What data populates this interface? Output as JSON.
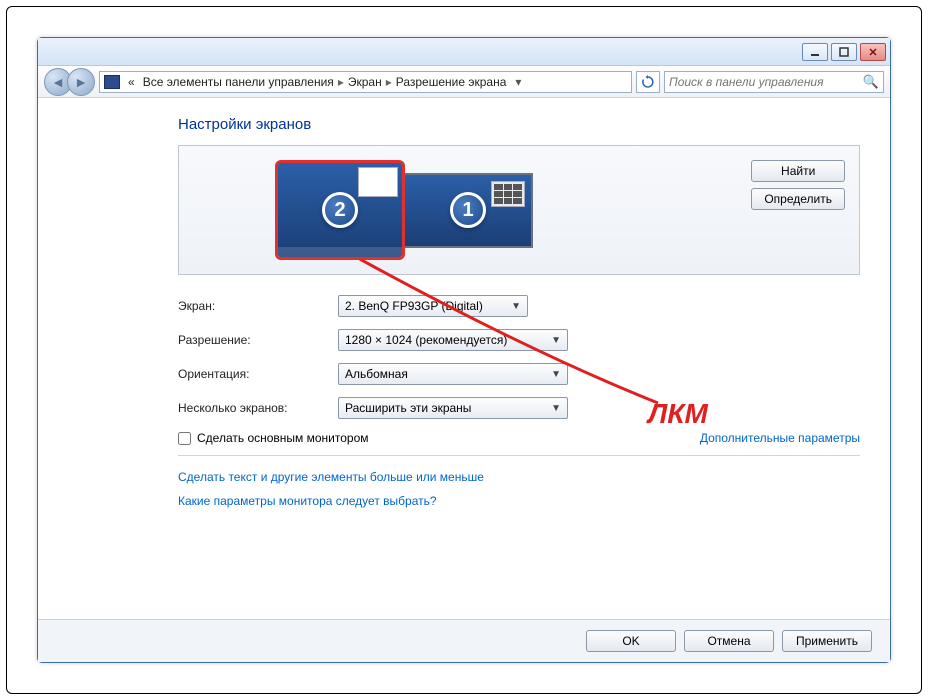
{
  "breadcrumb": {
    "seg1": "Все элементы панели управления",
    "seg2": "Экран",
    "seg3": "Разрешение экрана",
    "prefix": "«"
  },
  "search": {
    "placeholder": "Поиск в панели управления"
  },
  "heading": "Настройки экранов",
  "monitors": {
    "num1": "1",
    "num2": "2"
  },
  "panel_buttons": {
    "find": "Найти",
    "identify": "Определить"
  },
  "labels": {
    "display": "Экран:",
    "resolution": "Разрешение:",
    "orientation": "Ориентация:",
    "multiple": "Несколько экранов:"
  },
  "dropdowns": {
    "display": "2. BenQ FP93GP (Digital)",
    "resolution": "1280 × 1024 (рекомендуется)",
    "orientation": "Альбомная",
    "multiple": "Расширить эти экраны"
  },
  "checkbox": {
    "label": "Сделать основным монитором"
  },
  "links": {
    "advanced": "Дополнительные параметры",
    "text_size": "Сделать текст и другие элементы больше или меньше",
    "which_params": "Какие параметры монитора следует выбрать?"
  },
  "buttons": {
    "ok": "OK",
    "cancel": "Отмена",
    "apply": "Применить"
  },
  "annotation": {
    "text": "ЛКМ"
  }
}
